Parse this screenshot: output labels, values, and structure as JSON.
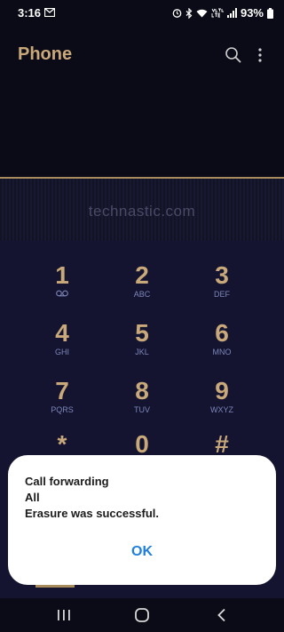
{
  "status_bar": {
    "time": "3:16",
    "battery": "93%",
    "icons": [
      "mail-icon",
      "alarm-icon",
      "bluetooth-icon",
      "wifi-icon",
      "volte-lte-icon",
      "signal-icon",
      "battery-icon"
    ]
  },
  "header": {
    "title": "Phone",
    "search_icon": "search-icon",
    "more_icon": "more-vert-icon"
  },
  "watermark": "technastic.com",
  "keypad": {
    "keys": [
      {
        "digit": "1",
        "letters": ""
      },
      {
        "digit": "2",
        "letters": "ABC"
      },
      {
        "digit": "3",
        "letters": "DEF"
      },
      {
        "digit": "4",
        "letters": "GHI"
      },
      {
        "digit": "5",
        "letters": "JKL"
      },
      {
        "digit": "6",
        "letters": "MNO"
      },
      {
        "digit": "7",
        "letters": "PQRS"
      },
      {
        "digit": "8",
        "letters": "TUV"
      },
      {
        "digit": "9",
        "letters": "WXYZ"
      },
      {
        "digit": "*",
        "letters": ""
      },
      {
        "digit": "0",
        "letters": ""
      },
      {
        "digit": "#",
        "letters": ""
      }
    ]
  },
  "dialog": {
    "line1": "Call forwarding",
    "line2": "All",
    "line3": "Erasure was successful.",
    "ok_label": "OK"
  },
  "nav_bar": {
    "recents_icon": "recents-icon",
    "home_icon": "home-icon",
    "back_icon": "back-icon"
  },
  "colors": {
    "accent_gold": "#c9a97a",
    "dialog_ok_blue": "#1f7fdc",
    "keypad_bg": "#141431",
    "letters": "#7d86b8"
  }
}
